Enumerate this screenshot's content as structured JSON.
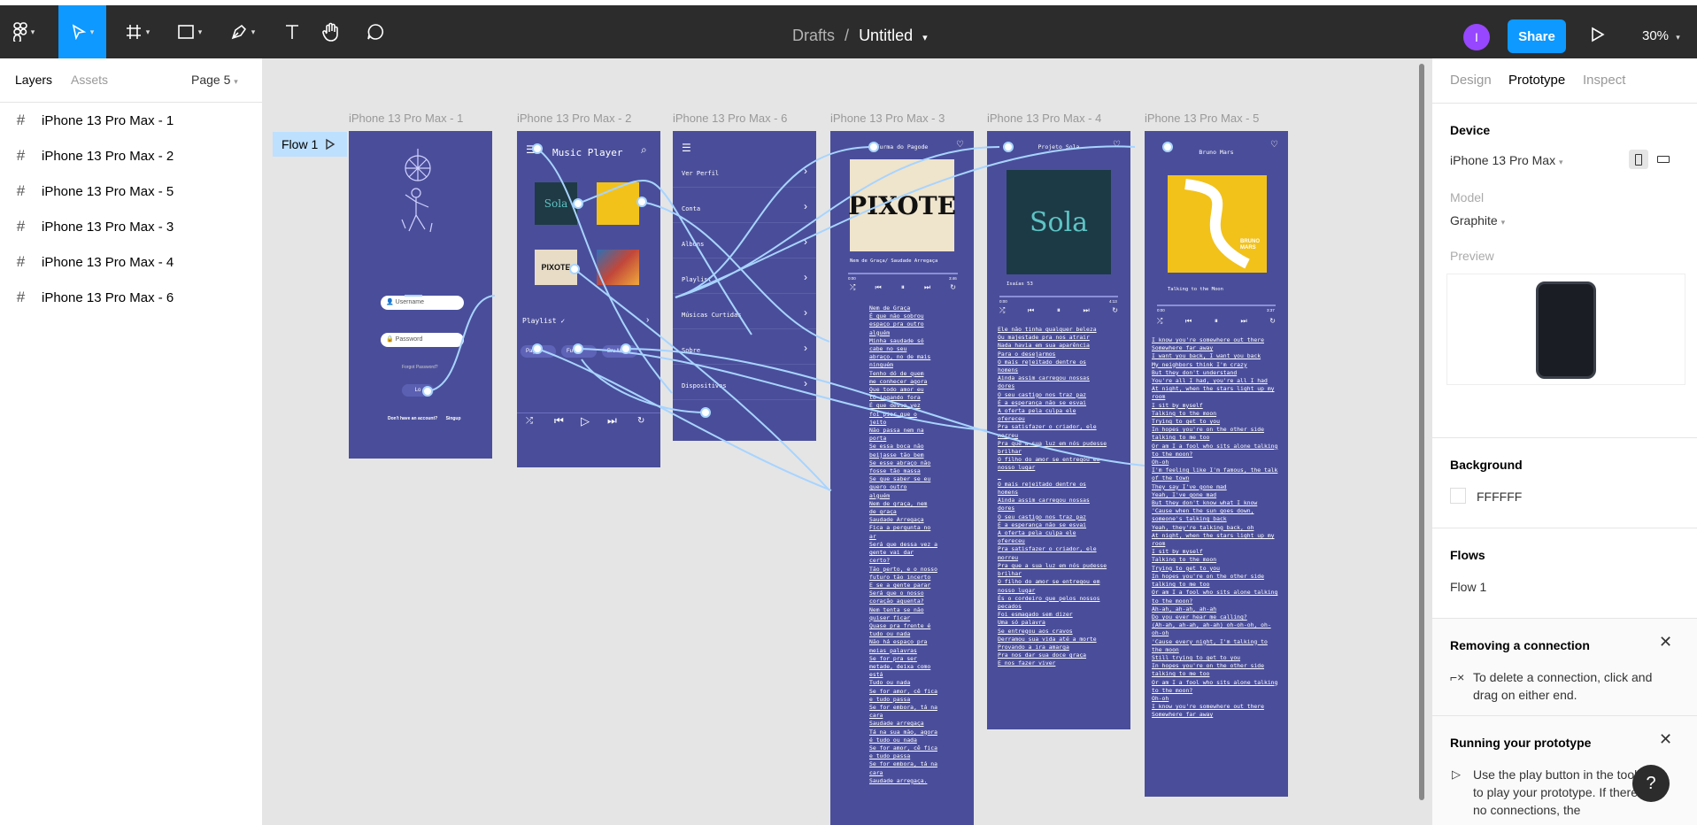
{
  "toolbar": {
    "title_drafts": "Drafts",
    "title_sep": "/",
    "title_name": "Untitled",
    "avatar_initial": "I",
    "share_label": "Share",
    "zoom": "30%"
  },
  "left_panel": {
    "tab_layers": "Layers",
    "tab_assets": "Assets",
    "page": "Page 5",
    "layers": [
      "iPhone 13 Pro Max - 1",
      "iPhone 13 Pro Max - 2",
      "iPhone 13 Pro Max - 5",
      "iPhone 13 Pro Max - 3",
      "iPhone 13 Pro Max - 4",
      "iPhone 13 Pro Max - 6"
    ]
  },
  "canvas": {
    "flow_label": "Flow 1",
    "frames": [
      "iPhone 13 Pro Max - 1",
      "iPhone 13 Pro Max - 2",
      "iPhone 13 Pro Max - 6",
      "iPhone 13 Pro Max - 3",
      "iPhone 13 Pro Max - 4",
      "iPhone 13 Pro Max - 5"
    ],
    "login": {
      "username": "Username",
      "password": "Password",
      "forgot": "Forgot Password?",
      "login_btn": "Lo",
      "signup_text": "Don't have an account?",
      "signup_link": "Singup"
    },
    "player": {
      "title": "Music Player",
      "playlist": "Playlist",
      "chip1": "Pago",
      "chip2": "Fu",
      "chip3": "Bru M",
      "album_sola": "Sola",
      "album_pixote": "PIXOTE"
    },
    "menu": [
      "Ver Perfil",
      "Conta",
      "Albuns",
      "Playlist",
      "Músicas Curtidas",
      "Sobre",
      "Dispositivos"
    ],
    "song3": {
      "artist": "Turma do Pagode",
      "album": "PIXOTE",
      "song": "Nem de Graça/ Saudade Arregaça",
      "t_start": "0:00",
      "t_end": "3:46",
      "lyrics": [
        "Nem de Graça",
        "É que não sobrou",
        "espaço pra outro",
        "alguém",
        "Minha saudade só",
        "cabe no seu",
        "abraço, no de mais",
        "ninguém",
        "Tenho dó de quem",
        "me conhecer agora",
        "Que todo amor eu",
        "tô jogando fora",
        "É que dessa vez",
        "foi pior que o",
        "jeito",
        "Não passa nem na",
        "porta",
        "Se essa boca não",
        "beijasse tão bem",
        "Se esse abraço não",
        "fosse tão massa",
        "Se que saber se eu",
        "quero outro",
        "alguém",
        "Nem de graça, nem",
        "de graça",
        "Saudade Arregaça",
        "Fica a pergunta no",
        "ar",
        "Será que dessa vez a",
        "gente vai dar",
        "certo?",
        "Tão perto, e o nosso",
        "futuro tão incerto",
        "E se a gente parar",
        "Será que o nosso",
        "coração aguenta?",
        "Nem tenta se não",
        "quiser ficar",
        "Quase pra frente é",
        "tudo ou nada",
        "Não há espaço pra",
        "meias palavras",
        "Se for pra ser",
        "metade, deixa como",
        "está",
        "Tudo ou nada",
        "Se for amor, cê fica",
        "e tudo passa",
        "Se for embora, tá na",
        "cara",
        "Saudade arregaça",
        "Tá na sua mão, agora",
        "é tudo ou nada",
        "Se for amor, cê fica",
        "e tudo passa",
        "Se for embora, tá na",
        "cara",
        "Saudade arregaça."
      ]
    },
    "song4": {
      "artist": "Projeto Sola",
      "album": "Sola",
      "song": "Isaías 53",
      "t_start": "0:00",
      "t_end": "4:13",
      "lyrics": [
        "Ele não tinha qualquer beleza",
        "Ou majestade pra nos atrair",
        "Nada havia em sua aparência",
        "Para o desejarmos",
        "O mais rejeitado dentre os",
        "homens",
        "Ainda assim carregou nossas",
        "dores",
        "O seu castigo nos traz paz",
        "É a esperança não se esvai",
        "A oferta pela culpa ele",
        "ofereceu",
        "Pra satisfazer o criador, ele",
        "morreu",
        "Pra que a sua luz em nós pudesse",
        "brilhar",
        "O filho do amor se entregou em",
        "nosso lugar",
        "",
        "O mais rejeitado dentre os",
        "homens",
        "Ainda assim carregou nossas",
        "dores",
        "O seu castigo nos traz paz",
        "É a esperança não se esvai",
        "A oferta pela culpa ele",
        "ofereceu",
        "Pra satisfazer o criador, ele",
        "morreu",
        "Pra que a sua luz em nós pudesse",
        "brilhar",
        "O filho do amor se entregou em",
        "nosso lugar",
        "És o cordeiro que pelos nossos",
        "pecados",
        "Foi esmagado sem dizer",
        "Uma só palavra",
        "Se entregou aos cravos",
        "Derramou sua vida até a morte",
        "Provando a ira amarga",
        "Pra nos dar sua doce graça",
        "E nos fazer viver"
      ]
    },
    "song5": {
      "artist": "Bruno Mars",
      "album": "BRUNO MARS",
      "song": "Talking to the Moon",
      "t_start": "0:00",
      "t_end": "3:37",
      "lyrics": [
        "I know you're somewhere out there",
        "Somewhere far away",
        "I want you back, I want you back",
        "My neighbors think I'm crazy",
        "But they don't understand",
        "You're all I had, you're all I had",
        "At night, when the stars light up my",
        "room",
        "I sit by myself",
        "Talking to the moon",
        "Trying to get to you",
        "In hopes you're on the other side",
        "talking to me too",
        "Or am I a fool who sits alone talking",
        "to the moon?",
        "Oh-oh",
        "I'm feeling like I'm famous, the talk",
        "of the town",
        "They say I've gone mad",
        "Yeah, I've gone mad",
        "But they don't know what I know",
        "'Cause when the sun goes down,",
        "someone's talking back",
        "Yeah, they're talking back, oh",
        "At night, when the stars light up my",
        "room",
        "I sit by myself",
        "Talking to the moon",
        "Trying to get to you",
        "In hopes you're on the other side",
        "talking to me too",
        "Or am I a fool who sits alone talking",
        "to the moon?",
        "Ah-ah, ah-ah, ah-ah",
        "Do you ever hear me calling?",
        "(Ah-ah, ah-ah, ah-ah) oh-oh-oh, oh-",
        "oh-oh",
        "'Cause every night, I'm talking to",
        "the moon",
        "Still trying to get to you",
        "In hopes you're on the other side",
        "talking to me too",
        "Or am I a fool who sits alone talking",
        "to the moon?",
        "Oh-oh",
        "I know you're somewhere out there",
        "Somewhere far away"
      ]
    }
  },
  "right_panel": {
    "tab_design": "Design",
    "tab_prototype": "Prototype",
    "tab_inspect": "Inspect",
    "device_h": "Device",
    "device": "iPhone 13 Pro Max",
    "model_l": "Model",
    "model": "Graphite",
    "preview_l": "Preview",
    "background_h": "Background",
    "background": "FFFFFF",
    "flows_h": "Flows",
    "flow": "Flow 1",
    "tip1_h": "Removing a connection",
    "tip1": "To delete a connection, click and drag on either end.",
    "tip2_h": "Running your prototype",
    "tip2": "Use the play button in the toolbar to play your prototype. If there are no connections, the",
    "help": "?"
  },
  "colors": {
    "accent": "#0d99ff",
    "frame_bg": "#4a4e9a",
    "toolbar_bg": "#2c2c2c",
    "connector": "#a8d4ff"
  }
}
